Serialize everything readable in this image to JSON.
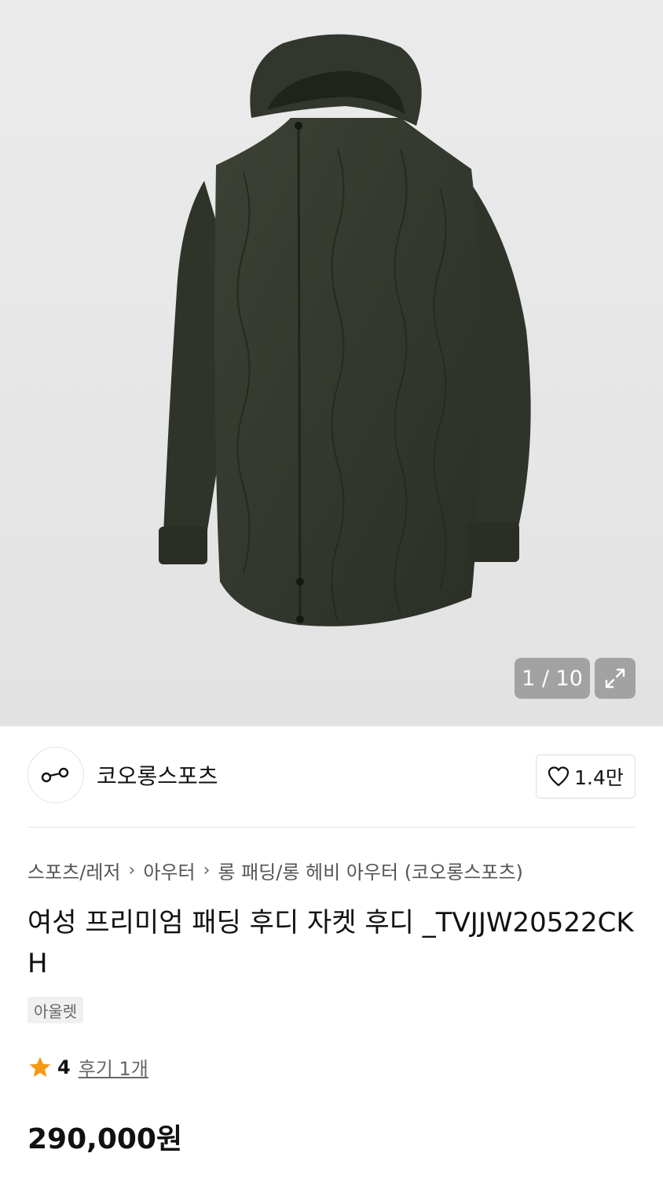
{
  "gallery": {
    "counter": "1 / 10",
    "expand_icon": "expand-icon"
  },
  "brand": {
    "name": "코오롱스포츠",
    "logo_icon": "brand-logo-icon",
    "like_count": "1.4만",
    "like_icon": "heart-icon"
  },
  "breadcrumb": [
    "스포츠/레저",
    "아우터",
    "롱 패딩/롱 헤비 아우터 (코오롱스포츠)"
  ],
  "product": {
    "title": "여성 프리미엄 패딩 후디 자켓 후디 _TVJJW20522CKH",
    "tag": "아울렛",
    "rating": "4",
    "reviews": "후기 1개",
    "price": "290,000원"
  },
  "colors": {
    "star": "#f59a16",
    "jacket": "#33382e"
  }
}
